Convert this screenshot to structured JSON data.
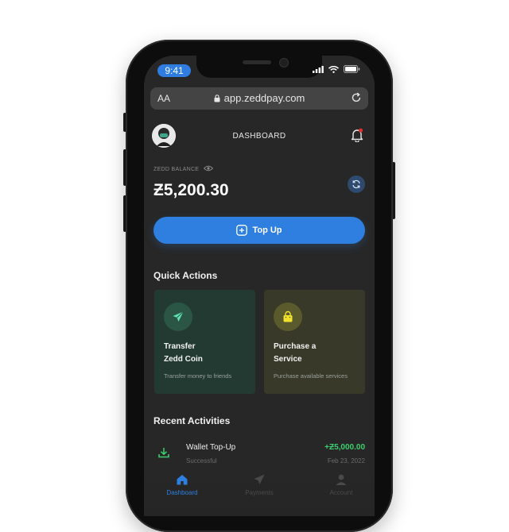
{
  "status_bar": {
    "time": "9:41"
  },
  "browser": {
    "text_size_label": "AA",
    "url": "app.zeddpay.com"
  },
  "header": {
    "title": "DASHBOARD"
  },
  "balance": {
    "label": "ZEDD BALANCE",
    "amount": "Ƶ5,200.30"
  },
  "top_up": {
    "label": "Top Up"
  },
  "quick_actions": {
    "title": "Quick Actions",
    "cards": [
      {
        "title_line1": "Transfer",
        "title_line2": "Zedd Coin",
        "subtitle": "Transfer money to friends"
      },
      {
        "title_line1": "Purchase a",
        "title_line2": "Service",
        "subtitle": "Purchase available services"
      }
    ]
  },
  "recent_activities": {
    "title": "Recent Activities",
    "items": [
      {
        "title": "Wallet Top-Up",
        "status": "Successful",
        "amount": "+Ƶ5,000.00",
        "date": "Feb 23, 2022"
      }
    ]
  },
  "tabs": [
    {
      "label": "Dashboard",
      "icon": "home-icon",
      "active": true
    },
    {
      "label": "Payments",
      "icon": "send-icon",
      "active": false
    },
    {
      "label": "Account",
      "icon": "user-icon",
      "active": false
    }
  ],
  "colors": {
    "accent": "#2e7fe0",
    "success": "#3ecf6e",
    "screen_bg": "#272727",
    "transfer_card": "#233a32",
    "purchase_card": "#39392a"
  }
}
